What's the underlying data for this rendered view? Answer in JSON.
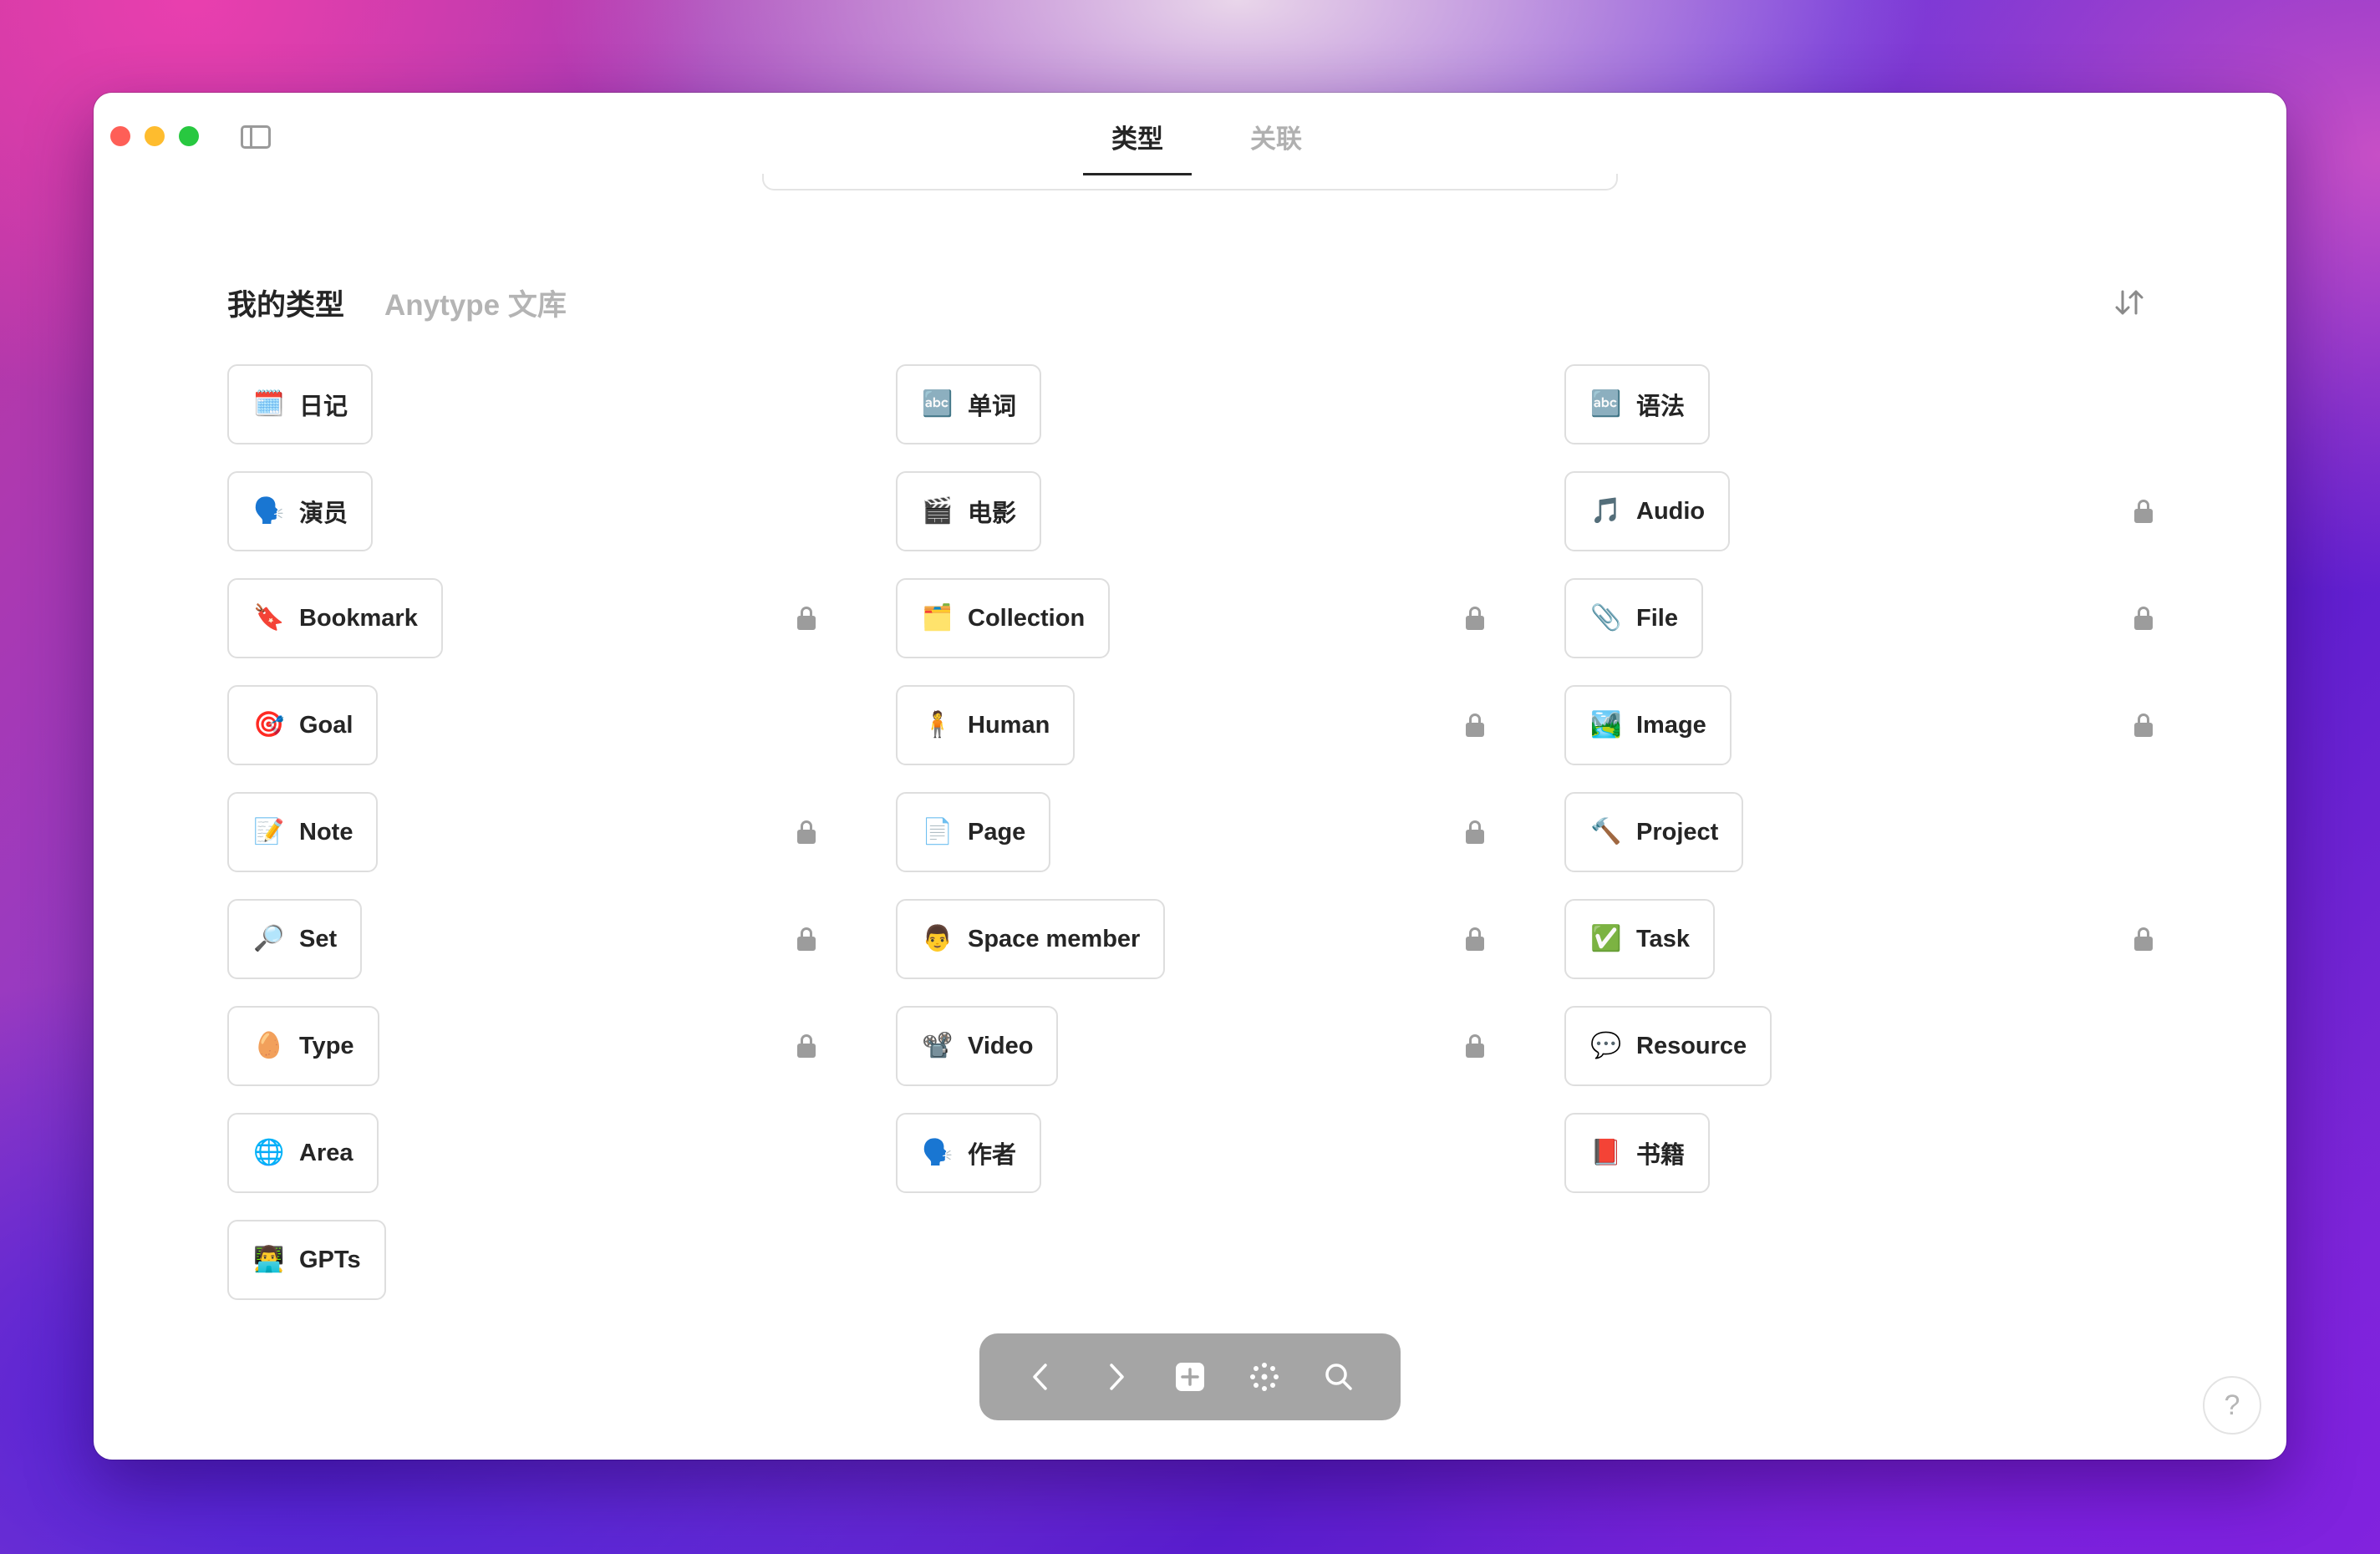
{
  "header": {
    "tabs": [
      {
        "label": "类型",
        "active": true
      },
      {
        "label": "关联",
        "active": false
      }
    ]
  },
  "section": {
    "tabs": [
      {
        "label": "我的类型",
        "active": true
      },
      {
        "label": "Anytype 文库",
        "active": false
      }
    ]
  },
  "types": {
    "columns": [
      [
        {
          "emoji": "🗓️",
          "label": "日记",
          "locked": false
        },
        {
          "emoji": "🗣️",
          "label": "演员",
          "locked": false
        },
        {
          "emoji": "🔖",
          "label": "Bookmark",
          "locked": true
        },
        {
          "emoji": "🎯",
          "label": "Goal",
          "locked": false
        },
        {
          "emoji": "📝",
          "label": "Note",
          "locked": true
        },
        {
          "emoji": "🔎",
          "label": "Set",
          "locked": true
        },
        {
          "emoji": "🥚",
          "label": "Type",
          "locked": true
        },
        {
          "emoji": "🌐",
          "label": "Area",
          "locked": false
        },
        {
          "emoji": "👨‍💻",
          "label": "GPTs",
          "locked": false
        }
      ],
      [
        {
          "emoji": "🔤",
          "label": "单词",
          "locked": false
        },
        {
          "emoji": "🎬",
          "label": "电影",
          "locked": false
        },
        {
          "emoji": "🗂️",
          "label": "Collection",
          "locked": true
        },
        {
          "emoji": "🧍",
          "label": "Human",
          "locked": true
        },
        {
          "emoji": "📄",
          "label": "Page",
          "locked": true
        },
        {
          "emoji": "👨",
          "label": "Space member",
          "locked": true
        },
        {
          "emoji": "📽️",
          "label": "Video",
          "locked": true
        },
        {
          "emoji": "🗣️",
          "label": "作者",
          "locked": false
        }
      ],
      [
        {
          "emoji": "🔤",
          "label": "语法",
          "locked": false
        },
        {
          "emoji": "🎵",
          "label": "Audio",
          "locked": true
        },
        {
          "emoji": "📎",
          "label": "File",
          "locked": true
        },
        {
          "emoji": "🏞️",
          "label": "Image",
          "locked": true
        },
        {
          "emoji": "🔨",
          "label": "Project",
          "locked": false
        },
        {
          "emoji": "✅",
          "label": "Task",
          "locked": true
        },
        {
          "emoji": "💬",
          "label": "Resource",
          "locked": false
        },
        {
          "emoji": "📕",
          "label": "书籍",
          "locked": false
        }
      ]
    ]
  },
  "navbar": {
    "buttons": [
      "back-icon",
      "forward-icon",
      "plus-icon",
      "graph-icon",
      "search-icon"
    ]
  },
  "help": {
    "label": "?"
  },
  "colors": {
    "accent": "#252525",
    "muted": "#b0b0b0",
    "navbar": "#a5a5a5"
  }
}
